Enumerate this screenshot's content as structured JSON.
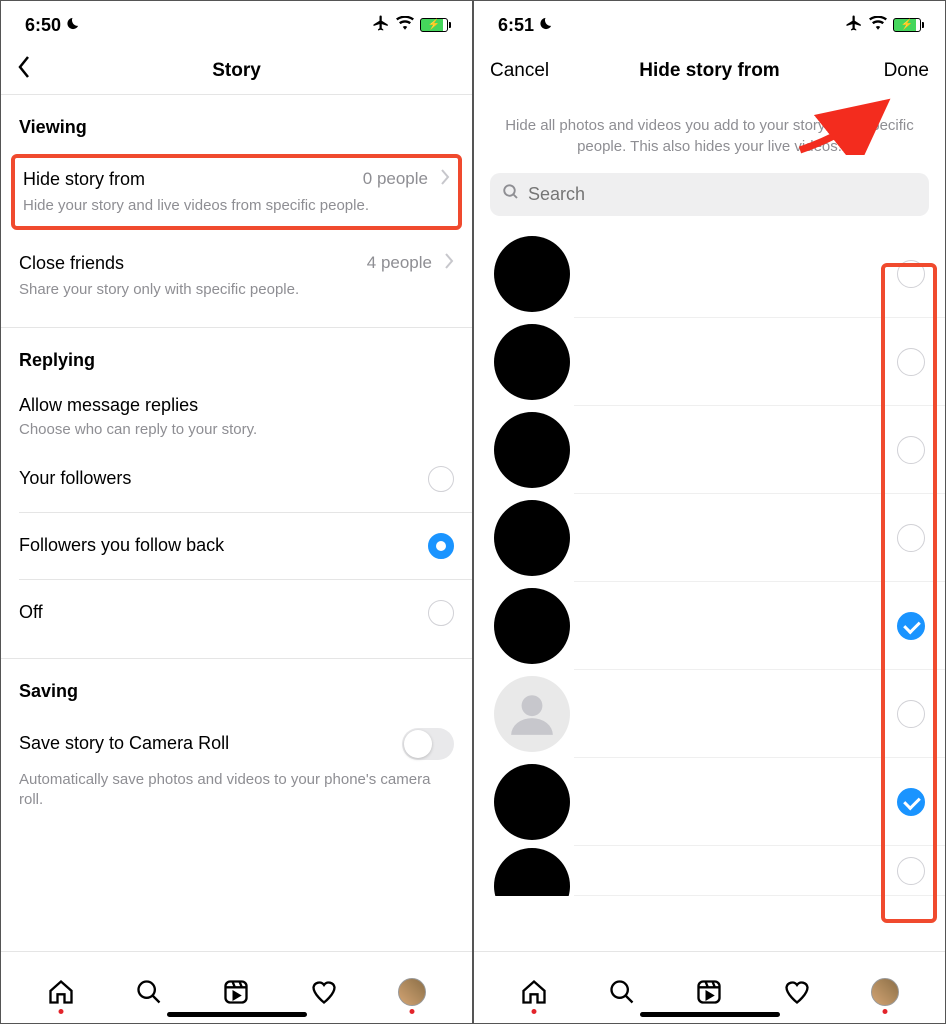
{
  "screen1": {
    "status": {
      "time": "6:50"
    },
    "nav": {
      "title": "Story"
    },
    "viewing": {
      "header": "Viewing",
      "hide": {
        "title": "Hide story from",
        "value": "0 people",
        "subtitle": "Hide your story and live videos from specific people."
      },
      "close_friends": {
        "title": "Close friends",
        "value": "4 people",
        "subtitle": "Share your story only with specific people."
      }
    },
    "replying": {
      "header": "Replying",
      "allow": {
        "title": "Allow message replies",
        "subtitle": "Choose who can reply to your story."
      },
      "options": {
        "followers": "Your followers",
        "follow_back": "Followers you follow back",
        "off": "Off"
      }
    },
    "saving": {
      "header": "Saving",
      "camera_roll": {
        "title": "Save story to Camera Roll",
        "subtitle": "Automatically save photos and videos to your phone's camera roll."
      }
    }
  },
  "screen2": {
    "status": {
      "time": "6:51"
    },
    "nav": {
      "cancel": "Cancel",
      "title": "Hide story from",
      "done": "Done"
    },
    "description": "Hide all photos and videos you add to your story from specific people. This also hides your live videos.",
    "search": {
      "placeholder": "Search"
    },
    "users": [
      {
        "checked": false,
        "placeholder": false
      },
      {
        "checked": false,
        "placeholder": false
      },
      {
        "checked": false,
        "placeholder": false
      },
      {
        "checked": false,
        "placeholder": false
      },
      {
        "checked": true,
        "placeholder": false
      },
      {
        "checked": false,
        "placeholder": true
      },
      {
        "checked": true,
        "placeholder": false
      },
      {
        "checked": false,
        "placeholder": false
      }
    ]
  }
}
